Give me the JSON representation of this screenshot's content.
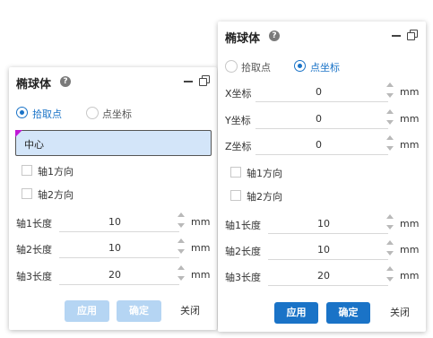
{
  "left_panel": {
    "title": "椭球体",
    "help": "?",
    "radios": [
      {
        "label": "拾取点",
        "checked": true
      },
      {
        "label": "点坐标",
        "checked": false
      }
    ],
    "selector_text": "中心",
    "checkboxes": [
      {
        "label": "轴1方向",
        "checked": false
      },
      {
        "label": "轴2方向",
        "checked": false
      }
    ],
    "fields": [
      {
        "label": "轴1长度",
        "value": "10",
        "unit": "mm"
      },
      {
        "label": "轴2长度",
        "value": "10",
        "unit": "mm"
      },
      {
        "label": "轴3长度",
        "value": "20",
        "unit": "mm"
      }
    ],
    "buttons": {
      "apply": "应用",
      "ok": "确定",
      "close": "关闭"
    },
    "buttons_disabled": true
  },
  "right_panel": {
    "title": "椭球体",
    "help": "?",
    "radios": [
      {
        "label": "拾取点",
        "checked": false
      },
      {
        "label": "点坐标",
        "checked": true
      }
    ],
    "coord_fields": [
      {
        "label": "X坐标",
        "value": "0",
        "unit": "mm"
      },
      {
        "label": "Y坐标",
        "value": "0",
        "unit": "mm"
      },
      {
        "label": "Z坐标",
        "value": "0",
        "unit": "mm"
      }
    ],
    "checkboxes": [
      {
        "label": "轴1方向",
        "checked": false
      },
      {
        "label": "轴2方向",
        "checked": false
      }
    ],
    "fields": [
      {
        "label": "轴1长度",
        "value": "10",
        "unit": "mm"
      },
      {
        "label": "轴2长度",
        "value": "10",
        "unit": "mm"
      },
      {
        "label": "轴3长度",
        "value": "20",
        "unit": "mm"
      }
    ],
    "buttons": {
      "apply": "应用",
      "ok": "确定",
      "close": "关闭"
    },
    "buttons_disabled": false
  },
  "colors": {
    "accent": "#1a73c7",
    "accent_disabled": "#b5d5f3",
    "selector_bg": "#d3e5f9",
    "marker": "#c018d6"
  },
  "icons": {
    "help": "help-circle-icon",
    "minimize": "minimize-icon",
    "restore": "restore-window-icon"
  }
}
